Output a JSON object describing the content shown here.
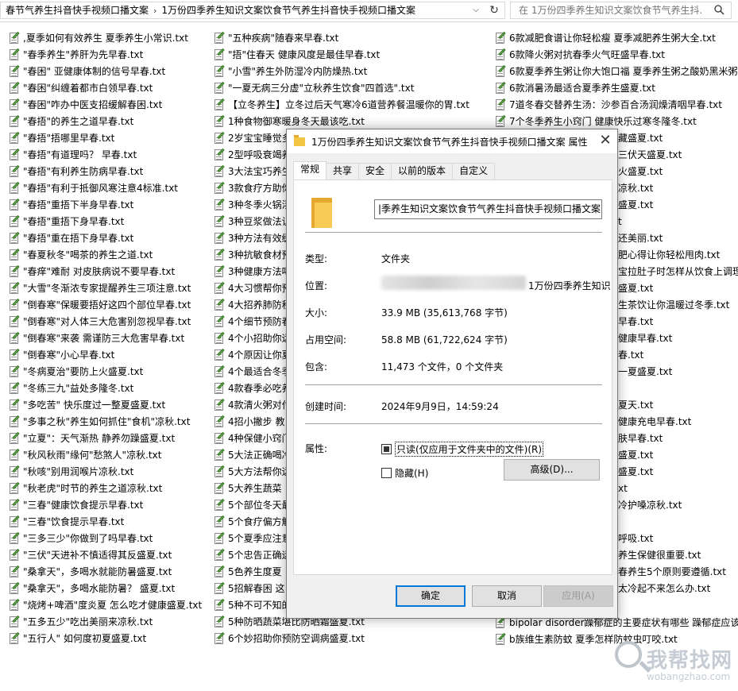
{
  "address_bar": {
    "crumb1": "春节气养生抖音快手视频口播文案",
    "crumb2": "1万份四季养生知识文案饮食节气养生抖音快手视频口播文案"
  },
  "search": {
    "placeholder": "在 1万份四季养生知识文案饮食节气养生抖..."
  },
  "files": {
    "col1": [
      ",夏季如何有效养生 夏季养生小常识.txt",
      "\"春季养生\"养肝为先早春.txt",
      "\"春困\"  亚健康体制的信号早春.txt",
      "\"春困\"纠缠着都市白领早春.txt",
      "\"春困\"咋办中医支招缓解春困.txt",
      "\"春捂\"的养生之道早春.txt",
      "\"春捂\"捂哪里早春.txt",
      "\"春捂\"有道理吗？ 早春.txt",
      "\"春捂\"有利养生防病早春.txt",
      "\"春捂\"有利于抵御风寒注意4标准.txt",
      "\"春捂\"重捂下半身早春.txt",
      "\"春捂\"重捂下身早春.txt",
      "\"春捂\"重在捂下身早春.txt",
      "\"春夏秋冬\"喝茶的养生之道.txt",
      "\"春痒\"难耐 对皮肤病说不要早春.txt",
      "\"大雪\"冬渐浓专家提醒养生三项注意.txt",
      "\"倒春寒\"保暖要捂好这四个部位早春.txt",
      "\"倒春寒\"对人体三大危害别忽视早春.txt",
      "\"倒春寒\"来袭 需谨防三大危害早春.txt",
      "\"倒春寒\"小心早春.txt",
      "\"冬病夏治\"要防上火盛夏.txt",
      "\"冬练三九\"益处多隆冬.txt",
      "\"多吃苦\" 快乐度过一整夏盛夏.txt",
      "\"多事之秋\"养生如何抓住\"食机\"凉秋.txt",
      "\"立夏\"：天气渐热 静养勿躁盛夏.txt",
      "\"秋风秋雨\"缘何\"愁煞人\"凉秋.txt",
      "\"秋咳\"别用润喉片凉秋.txt",
      "\"秋老虎\"时节的养生之道凉秋.txt",
      "\"三春\"健康饮食提示早春.txt",
      "\"三春\"饮食提示早春.txt",
      "\"三多三少\"你做到了吗早春.txt",
      "\"三伏\"天进补不慎适得其反盛夏.txt",
      "\"桑拿天\"，多喝水就能防暑盛夏.txt",
      "\"桑拿天\"，多喝水能防暑？ 盛夏.txt",
      "\"烧烤+啤酒\"度炎夏 怎么吃才健康盛夏.txt",
      "\"五多五少\"吃出美丽来凉秋.txt",
      "\"五行人\" 如何度初夏盛夏.txt"
    ],
    "col2": [
      "\"五种疾病\"随春来早春.txt",
      "\"捂\"住春天 健康风度是最佳早春.txt",
      "\"小雪\"养生外防湿冷内防燥热.txt",
      "\"一夏无病三分虚\"立秋养生饮食\"四首选\".txt",
      "【立冬养生】立冬过后天气寒冷6道营养餐温暖你的胃.txt",
      "1种食物御寒暖身冬天最该吃.txt",
      "2岁宝宝睡觉多",
      "2型呼吸衰竭养",
      "3大法宝巧养生",
      "3款食疗方助你",
      "3种冬季火锅汤",
      "3种豆浆做法让",
      "3种方法有效缓",
      "3种抗敏食材预",
      "3种健康方法喝",
      "4大习惯帮你预",
      "4大招养肺防秋",
      "4个细节预防春",
      "4个小招助你远",
      "4个原因让你夏",
      "4个最适合冬季",
      "4款春季必吃养",
      "4款清火粥对付",
      "4招小撇步 教",
      "4种保健小窍门",
      "5大法正确喝冷",
      "5大方法帮你远",
      "5大养生蔬菜",
      "5个部位冬天最",
      "5个食疗偏方解",
      "5个夏季应注意",
      "5个忠告正确运",
      "5色养生度夏",
      "5招解春困 这",
      "5种不可不知的",
      "5种防晒蔬菜堪比防晒霜盛夏.txt",
      "6个妙招助你预防空调病盛夏.txt"
    ],
    "col3": [
      "6款减肥食谱让你轻松瘦 夏季减肥养生粥大全.txt",
      "6款降火粥对抗春季火气旺盛早春.txt",
      "6款夏季养生粥让你大饱口福 夏季养生粥之酸奶黑米粥",
      "6款消暑汤最适合夏季养生盛夏.txt",
      "7道冬春交替养生汤：沙参百合汤润燥清咽早春.txt",
      "7个冬季养生小窍门 健康快乐过寒冬隆冬.txt"
    ],
    "col3_right": [
      "藏盛夏.txt",
      "三伏天盛夏.txt",
      "火盛夏.txt",
      "凉秋.txt",
      "盛夏.txt",
      "t",
      "还美丽.txt",
      "肥心得让你轻松甩肉.txt",
      "宝拉肚子时怎样从饮食上调理",
      "盛夏.txt",
      "生茶饮让你温暖过冬季.txt",
      "早春.txt",
      "健康早春.txt",
      "春.txt",
      "一夏盛夏.txt",
      "",
      "夏天.txt",
      "健康充电早春.txt",
      "肤早春.txt",
      "盛夏.txt",
      "盛夏.txt",
      "xt",
      "冷护嗓凉秋.txt",
      "",
      "呼吸.txt",
      "养生保健很重要.txt",
      "春养生5个原则要遵循.txt",
      "太冷起不来怎么办.txt"
    ],
    "col3_bottom": [
      "bipolar disorder躁郁症的主要症状有哪些 躁郁症应该",
      "b族维生素防蚊 夏季怎样防蚊虫叮咬.txt"
    ]
  },
  "dialog": {
    "title": "1万份四季养生知识文案饮食节气养生抖音快手视频口播文案 属性",
    "tabs": [
      "常规",
      "共享",
      "安全",
      "以前的版本",
      "自定义"
    ],
    "name": "|季养生知识文案饮食节气养生抖音快手视频口播文案",
    "type_label": "类型:",
    "type_value": "文件夹",
    "location_label": "位置:",
    "location_value": "1万份四季养生知识",
    "size_label": "大小:",
    "size_value": "33.9 MB (35,613,768 字节)",
    "disk_label": "占用空间:",
    "disk_value": "58.8 MB (61,722,624 字节)",
    "contains_label": "包含:",
    "contains_value": "11,473 个文件，0 个文件夹",
    "created_label": "创建时间:",
    "created_value": "2024年9月9日，14:59:24",
    "attr_label": "属性:",
    "readonly_label": "只读(仅应用于文件夹中的文件)(R)",
    "hidden_label": "隐藏(H)",
    "advanced_label": "高级(D)...",
    "ok_label": "确定",
    "cancel_label": "取消",
    "apply_label": "应用(A)"
  },
  "watermark": {
    "t1": "我帮找网",
    "t2": "wobangzhao.com"
  }
}
